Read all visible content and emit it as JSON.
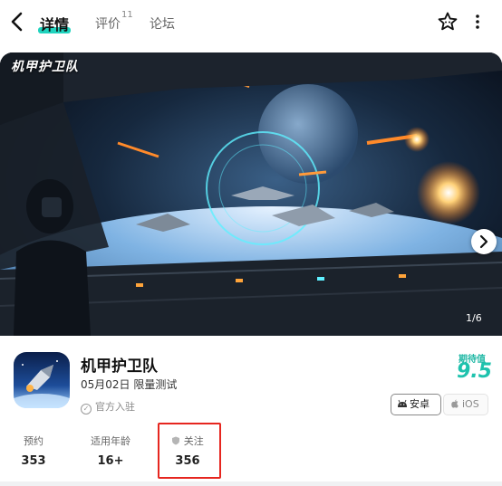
{
  "nav": {
    "tabs": [
      {
        "label": "详情",
        "active": true
      },
      {
        "label": "评价",
        "badge": "11"
      },
      {
        "label": "论坛"
      }
    ],
    "icons": [
      "back-icon",
      "star-icon",
      "more-icon"
    ]
  },
  "banner": {
    "title": "机甲护卫队",
    "counter": "1/6"
  },
  "app": {
    "name": "机甲护卫队",
    "date": "05月02日",
    "test_type": "限量测试",
    "official": "官方入驻"
  },
  "expectation": {
    "label": "期待值",
    "score": "9.5",
    "color": "#1ec2ad"
  },
  "platforms": {
    "android": "安卓",
    "ios": "iOS"
  },
  "stats": {
    "reserve": {
      "label": "预约",
      "value": "353"
    },
    "age": {
      "label": "适用年龄",
      "value": "16+"
    },
    "follow": {
      "label": "关注",
      "value": "356"
    }
  },
  "colors": {
    "accent": "#20d3be",
    "highlight_box": "#e6261f"
  }
}
